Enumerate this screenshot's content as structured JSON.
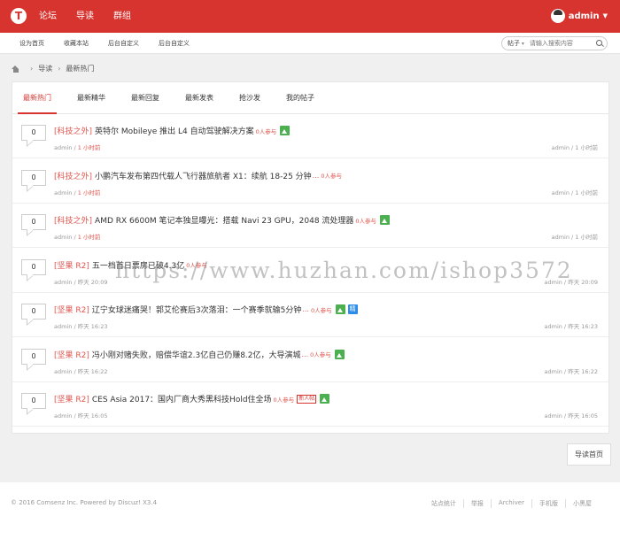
{
  "header": {
    "logo": "T",
    "nav": [
      "论坛",
      "导读",
      "群组"
    ],
    "user": "admin"
  },
  "subbar": {
    "links": [
      "设为首页",
      "收藏本站",
      "后台自定义",
      "后台自定义"
    ],
    "search_type": "帖子",
    "search_placeholder": "请输入搜索内容"
  },
  "breadcrumb": {
    "items": [
      "导读",
      "最新热门"
    ]
  },
  "tabs": [
    "最新热门",
    "最新精华",
    "最新回复",
    "最新发表",
    "抢沙发",
    "我的帖子"
  ],
  "threads": [
    {
      "count": "0",
      "category": "[科技之外]",
      "title": "英特尔 Mobileye 推出 L4 自动驾驶解决方案",
      "ellipsis": "",
      "join": "0人参与",
      "image": true,
      "jing": false,
      "new_badge": "",
      "meta_left_author": "admin",
      "meta_left_time": "1 小时前",
      "meta_right": "admin / 1 小时前"
    },
    {
      "count": "0",
      "category": "[科技之外]",
      "title": "小鹏汽车发布第四代载人飞行器旅航者 X1：续航 18-25 分钟",
      "ellipsis": "...",
      "join": "0人参与",
      "image": false,
      "jing": false,
      "new_badge": "",
      "meta_left_author": "admin",
      "meta_left_time": "1 小时前",
      "meta_right": "admin / 1 小时前"
    },
    {
      "count": "0",
      "category": "[科技之外]",
      "title": "AMD RX 6600M 笔记本独显曝光：搭载 Navi 23 GPU，2048 流处理器",
      "ellipsis": "",
      "join": "0人参与",
      "image": true,
      "jing": false,
      "new_badge": "",
      "meta_left_author": "admin",
      "meta_left_time": "1 小时前",
      "meta_right": "admin / 1 小时前"
    },
    {
      "count": "0",
      "category": "[坚果 R2]",
      "title": "五一档首日票房已破4.3亿",
      "ellipsis": "",
      "join": "0人参与",
      "image": false,
      "jing": false,
      "new_badge": "",
      "meta_left_author": "admin",
      "meta_left_time": "昨天 20:09",
      "meta_right": "admin / 昨天 20:09"
    },
    {
      "count": "0",
      "category": "[坚果 R2]",
      "title": "辽宁女球迷痛哭！郭艾伦赛后3次落泪：一个赛季就输5分钟",
      "ellipsis": "...",
      "join": "0人参与",
      "image": true,
      "jing": true,
      "new_badge": "",
      "meta_left_author": "admin",
      "meta_left_time": "昨天 16:23",
      "meta_right": "admin / 昨天 16:23"
    },
    {
      "count": "0",
      "category": "[坚果 R2]",
      "title": "冯小刚对赌失败，赔偿华谊2.3亿自己仍赚8.2亿，大导演城",
      "ellipsis": "...",
      "join": "0人参与",
      "image": true,
      "jing": false,
      "new_badge": "",
      "meta_left_author": "admin",
      "meta_left_time": "昨天 16:22",
      "meta_right": "admin / 昨天 16:22"
    },
    {
      "count": "0",
      "category": "[坚果 R2]",
      "title": "CES Asia 2017：国内厂商大秀黑科技Hold住全场",
      "ellipsis": "",
      "join": "0人参与",
      "image": true,
      "jing": false,
      "new_badge": "新人帖",
      "meta_left_author": "admin",
      "meta_left_time": "昨天 16:05",
      "meta_right": "admin / 昨天 16:05"
    }
  ],
  "watermark": "https://www.huzhan.com/ishop3572",
  "guide_button": "导读首页",
  "footer": {
    "copyright": "© 2016 Comsenz Inc. Powered by Discuz! X3.4",
    "links": [
      "站点统计",
      "举报",
      "Archiver",
      "手机版",
      "小黑屋"
    ]
  },
  "colors": {
    "brand_red": "#d8342f",
    "category_red": "#e0564f",
    "image_green": "#4caf50",
    "jing_blue": "#2e8de8"
  }
}
